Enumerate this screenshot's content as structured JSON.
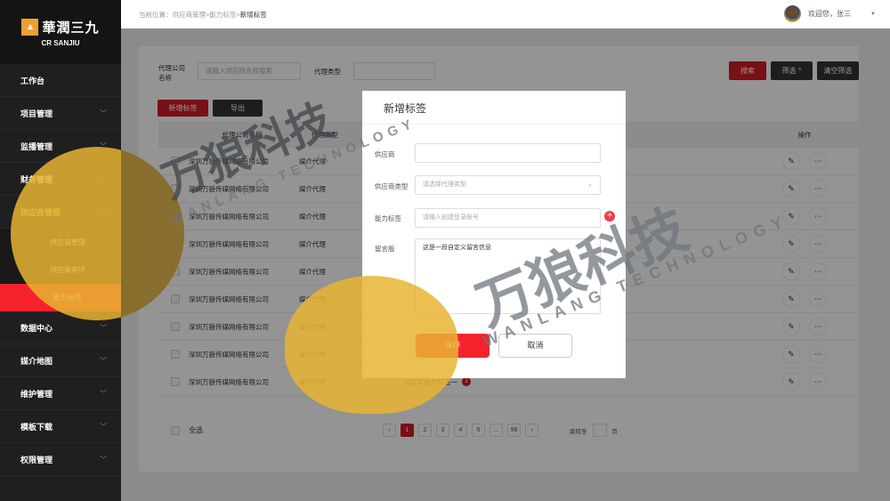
{
  "sidebar": {
    "logo_cn": "華潤三九",
    "logo_en": "CR SANJIU",
    "items": [
      "工作台",
      "项目管理",
      "监播管理",
      "财务管理",
      "供应商管理"
    ],
    "sub_items": [
      "供应商管理",
      "供应商考评",
      "能力标签"
    ],
    "items_after": [
      "数据中心",
      "媒介地图",
      "维护管理",
      "模板下载",
      "权限管理"
    ]
  },
  "header": {
    "breadcrumb_prefix": "当前位置：",
    "breadcrumb_path": "供应商管理>能力标签>",
    "breadcrumb_current": "新增标签",
    "welcome": "欢迎您，张三"
  },
  "filters": {
    "company_label": "代理公司名称",
    "company_placeholder": "请输入供应商名称搜索",
    "type_label": "代理类型",
    "search": "搜索",
    "filter": "筛选 ^",
    "clear": "清空筛选"
  },
  "actions": {
    "add": "新增标签",
    "export": "导出"
  },
  "table": {
    "headers": [
      "代理公司名称",
      "代理类型",
      "操作"
    ],
    "rows": [
      {
        "name": "深圳万狼传媒网络有限公司",
        "type": "媒介代理",
        "tag": "",
        "count": ""
      },
      {
        "name": "深圳万狼传媒网络有限公司",
        "type": "媒介代理",
        "tag": "",
        "count": ""
      },
      {
        "name": "深圳万狼传媒网络有限公司",
        "type": "媒介代理",
        "tag": "",
        "count": ""
      },
      {
        "name": "深圳万狼传媒网络有限公司",
        "type": "媒介代理",
        "tag": "",
        "count": ""
      },
      {
        "name": "深圳万狼传媒网络有限公司",
        "type": "媒介代理",
        "tag": "",
        "count": ""
      },
      {
        "name": "深圳万狼传媒网络有限公司",
        "type": "媒介代理",
        "tag": "",
        "count": ""
      },
      {
        "name": "深圳万狼传媒网络有限公司",
        "type": "媒介代理",
        "tag": "",
        "count": ""
      },
      {
        "name": "深圳万狼传媒网络有限公司",
        "type": "媒介代理",
        "tag": "",
        "count": ""
      },
      {
        "name": "深圳万狼传媒网络有限公司",
        "type": "媒介代理",
        "tag": "自定义能力标签一",
        "count": "3"
      }
    ]
  },
  "footer": {
    "select_all": "全选",
    "pages": [
      "1",
      "2",
      "3",
      "4",
      "5",
      "...",
      "99"
    ],
    "jump_label": "跳转至",
    "page_unit": "页"
  },
  "modal": {
    "title": "新增标签",
    "supplier_label": "供应商",
    "supplier_value": "",
    "type_label": "供应商类型",
    "type_placeholder": "请选择代理类型",
    "tag_label": "能力标签",
    "tag_placeholder": "请输入创建登录账号",
    "message_label": "留言版",
    "message_value": "这是一段自定义留言信息",
    "save": "保存",
    "cancel": "取消"
  },
  "watermark": {
    "cn": "万狼科技",
    "en": "WANLANG TECHNOLOGY"
  },
  "colors": {
    "accent": "#d01c25",
    "sidebar": "#1f1f1f",
    "active_menu": "#f5222d"
  }
}
